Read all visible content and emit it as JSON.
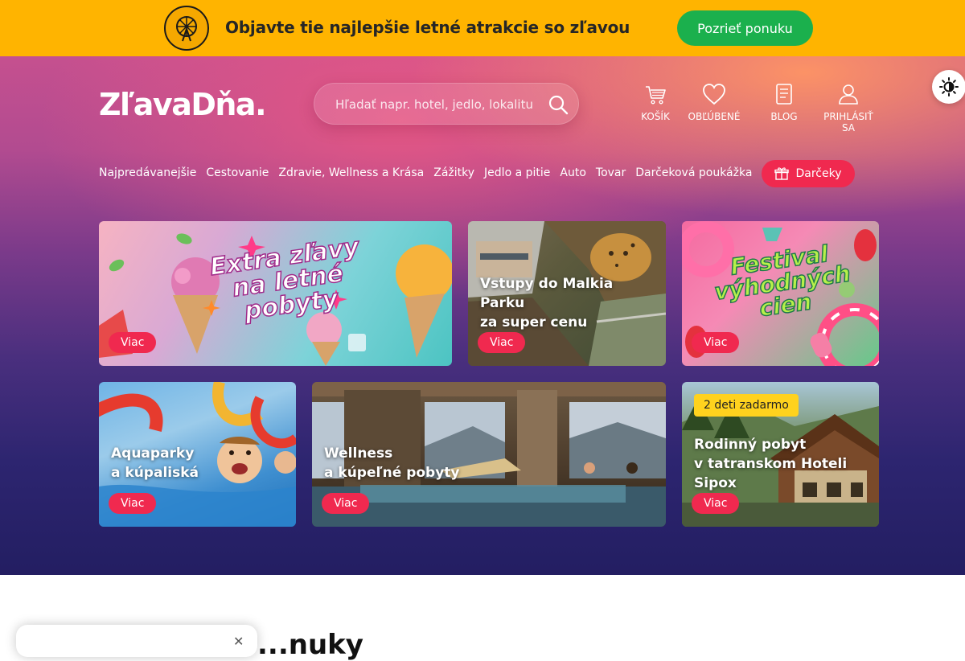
{
  "promo": {
    "text": "Objavte tie najlepšie letné atrakcie so zľavou",
    "button": "Pozrieť ponuku"
  },
  "header": {
    "logo": "ZľavaDňa.",
    "search_placeholder": "Hľadať napr. hotel, jedlo, lokalitu",
    "cart": "KOŠÍK",
    "favorites": "OBĽÚBENÉ",
    "blog": "BLOG",
    "login": "PRIHLÁSIŤ SA"
  },
  "categories": [
    "Najpredávanejšie",
    "Cestovanie",
    "Zdravie, Wellness a Krása",
    "Zážitky",
    "Jedlo a pitie",
    "Auto",
    "Tovar",
    "Darčeková poukážka"
  ],
  "gift_button": "Darčeky",
  "cards": [
    {
      "title": "",
      "art": "Extra zľavy\nna letné\npobyty",
      "button": "Viac"
    },
    {
      "title": "Vstupy do Malkia\nParku\nza super cenu",
      "button": "Viac"
    },
    {
      "title": "",
      "art": "Festival\nvýhodných\ncien",
      "button": "Viac"
    },
    {
      "title": "Aquaparky\na kúpaliská",
      "button": "Viac"
    },
    {
      "title": "Wellness\na kúpeľné pobyty",
      "button": "Viac"
    },
    {
      "title": "Rodinný pobyt\nv tatranskom Hoteli\nSipox",
      "tag": "2 deti zadarmo",
      "button": "Viac"
    }
  ],
  "section_heading": "...nuky",
  "colors": {
    "promo_bg": "#ffb400",
    "promo_button": "#1bb04d",
    "accent": "#f0294f",
    "tag": "#ffd21e"
  },
  "icons": [
    "ferris-wheel-icon",
    "search-icon",
    "cart-icon",
    "heart-icon",
    "blog-icon",
    "user-icon",
    "sun-icon",
    "gift-icon",
    "close-icon"
  ]
}
